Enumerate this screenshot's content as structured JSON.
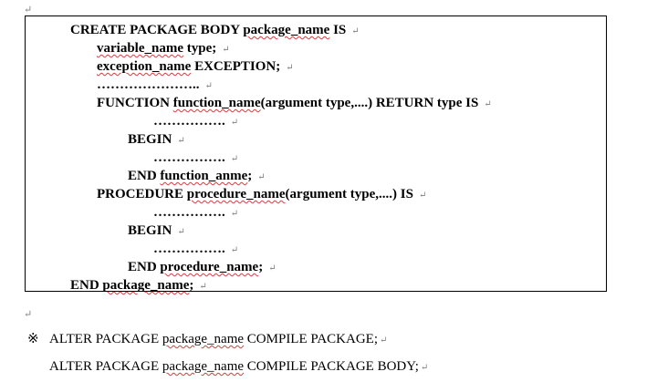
{
  "document": {
    "paragraph_mark": "↵",
    "code": [
      {
        "indent": 48,
        "parts": [
          {
            "t": "CREATE PACKAGE BODY "
          },
          {
            "t": "package_name",
            "wavy": true
          },
          {
            "t": " IS"
          }
        ]
      },
      {
        "indent": 77,
        "parts": [
          {
            "t": "variable_name",
            "wavy": true
          },
          {
            "t": "       type;"
          }
        ]
      },
      {
        "indent": 77,
        "parts": [
          {
            "t": "exception_name",
            "wavy": true
          },
          {
            "t": " EXCEPTION;"
          }
        ]
      },
      {
        "indent": 77,
        "parts": [
          {
            "t": "………………….."
          }
        ]
      },
      {
        "indent": 77,
        "parts": [
          {
            "t": "FUNCTION "
          },
          {
            "t": "function_name",
            "wavy": true
          },
          {
            "t": "(argument type,....) RETURN type IS"
          }
        ]
      },
      {
        "indent": 139,
        "parts": [
          {
            "t": "……………."
          }
        ]
      },
      {
        "indent": 111,
        "parts": [
          {
            "t": "BEGIN"
          }
        ]
      },
      {
        "indent": 139,
        "parts": [
          {
            "t": "……………."
          }
        ]
      },
      {
        "indent": 111,
        "parts": [
          {
            "t": "END "
          },
          {
            "t": "function_anme",
            "wavy": true
          },
          {
            "t": ";"
          }
        ]
      },
      {
        "indent": 77,
        "parts": [
          {
            "t": "PROCEDURE "
          },
          {
            "t": "procedure_name",
            "wavy": true
          },
          {
            "t": "(argument type,....) IS"
          }
        ]
      },
      {
        "indent": 139,
        "parts": [
          {
            "t": "……………."
          }
        ]
      },
      {
        "indent": 111,
        "parts": [
          {
            "t": "BEGIN"
          }
        ]
      },
      {
        "indent": 139,
        "parts": [
          {
            "t": "……………."
          }
        ]
      },
      {
        "indent": 111,
        "parts": [
          {
            "t": "END "
          },
          {
            "t": "procedure_name",
            "wavy": true
          },
          {
            "t": ";"
          }
        ]
      },
      {
        "indent": 48,
        "parts": [
          {
            "t": "END "
          },
          {
            "t": "package_name",
            "wavy": true
          },
          {
            "t": ";"
          }
        ]
      }
    ],
    "notes": [
      {
        "symbol": "※",
        "parts": [
          {
            "t": "ALTER PACKAGE "
          },
          {
            "t": "package_name",
            "wavy": true
          },
          {
            "t": " COMPILE PACKAGE;"
          }
        ]
      },
      {
        "symbol": "",
        "parts": [
          {
            "t": "ALTER PACKAGE "
          },
          {
            "t": "package_name",
            "wavy": true
          },
          {
            "t": " COMPILE PACKAGE BODY;"
          }
        ]
      }
    ]
  }
}
